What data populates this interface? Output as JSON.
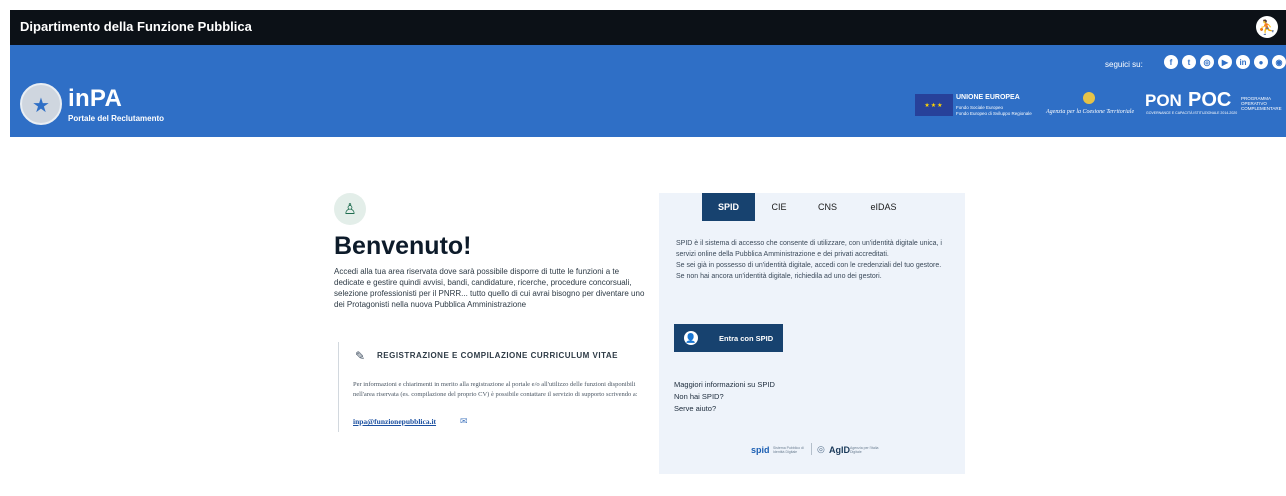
{
  "topbar": {
    "department": "Dipartimento della Funzione Pubblica",
    "accessibility_icon": "accessibility-icon"
  },
  "header": {
    "brand": "inPA",
    "brand_subtitle": "Portale del Reclutamento",
    "follow_label": "seguici su:",
    "socials": [
      "facebook-icon",
      "twitter-icon",
      "instagram-icon",
      "youtube-icon",
      "linkedin-icon",
      "flickr-icon",
      "rss-icon"
    ],
    "eu_title": "UNIONE EUROPEA",
    "eu_line1": "Fondo Sociale Europeo",
    "eu_line2": "Fondo Europeo di Sviluppo Regionale",
    "coesione": "Agenzia per la Coesione Territoriale",
    "pon": "PON",
    "pon_subtitle": "GOVERNANCE E CAPACITÀ ISTITUZIONALE 2014-2020",
    "poc": "POC",
    "poc_line1": "PROGRAMMA",
    "poc_line2": "OPERATIVO",
    "poc_line3": "COMPLEMENTARE"
  },
  "welcome": {
    "title": "Benvenuto!",
    "body": "Accedi alla tua area riservata dove sarà possibile disporre di tutte le funzioni a te dedicate e gestire quindi avvisi, bandi, candidature, ricerche, procedure concorsuali, selezione professionisti per il PNRR... tutto quello di cui avrai bisogno per diventare uno dei Protagonisti nella nuova Pubblica Amministrazione",
    "reg_title": "REGISTRAZIONE E COMPILAZIONE CURRICULUM VITAE",
    "reg_body": "Per informazioni e chiarimenti in merito alla registrazione al portale e/o all'utilizzo delle funzioni disponibili nell'area riservata (es. compilazione del proprio CV) è possibile contattare il servizio di supporto scrivendo a:",
    "reg_email": "inpa@funzionepubblica.it"
  },
  "login": {
    "tabs": [
      "SPID",
      "CIE",
      "CNS",
      "eIDAS"
    ],
    "active_tab": "SPID",
    "description": "SPID è il sistema di accesso che consente di utilizzare, con un'identità digitale unica, i servizi online della Pubblica Amministrazione e dei privati accreditati.",
    "have_spid": "Se sei già in possesso di un'identità digitale, accedi con le credenziali del tuo gestore.",
    "no_spid_yet": "Se non hai ancora un'identità digitale, richiedila ad uno dei gestori.",
    "button_label": "Entra con SPID",
    "links": [
      "Maggiori informazioni su SPID",
      "Non hai SPID?",
      "Serve aiuto?"
    ],
    "spid_logo": "spid",
    "spid_caption": "Sistema Pubblico di Identità Digitale",
    "agid_logo": "AgID",
    "agid_caption": "Agenzia per l'Italia Digitale"
  },
  "colors": {
    "topbar": "#0c1117",
    "header": "#2f6fc6",
    "spid_blue": "#17426f",
    "panel_bg": "#eef3fa"
  }
}
